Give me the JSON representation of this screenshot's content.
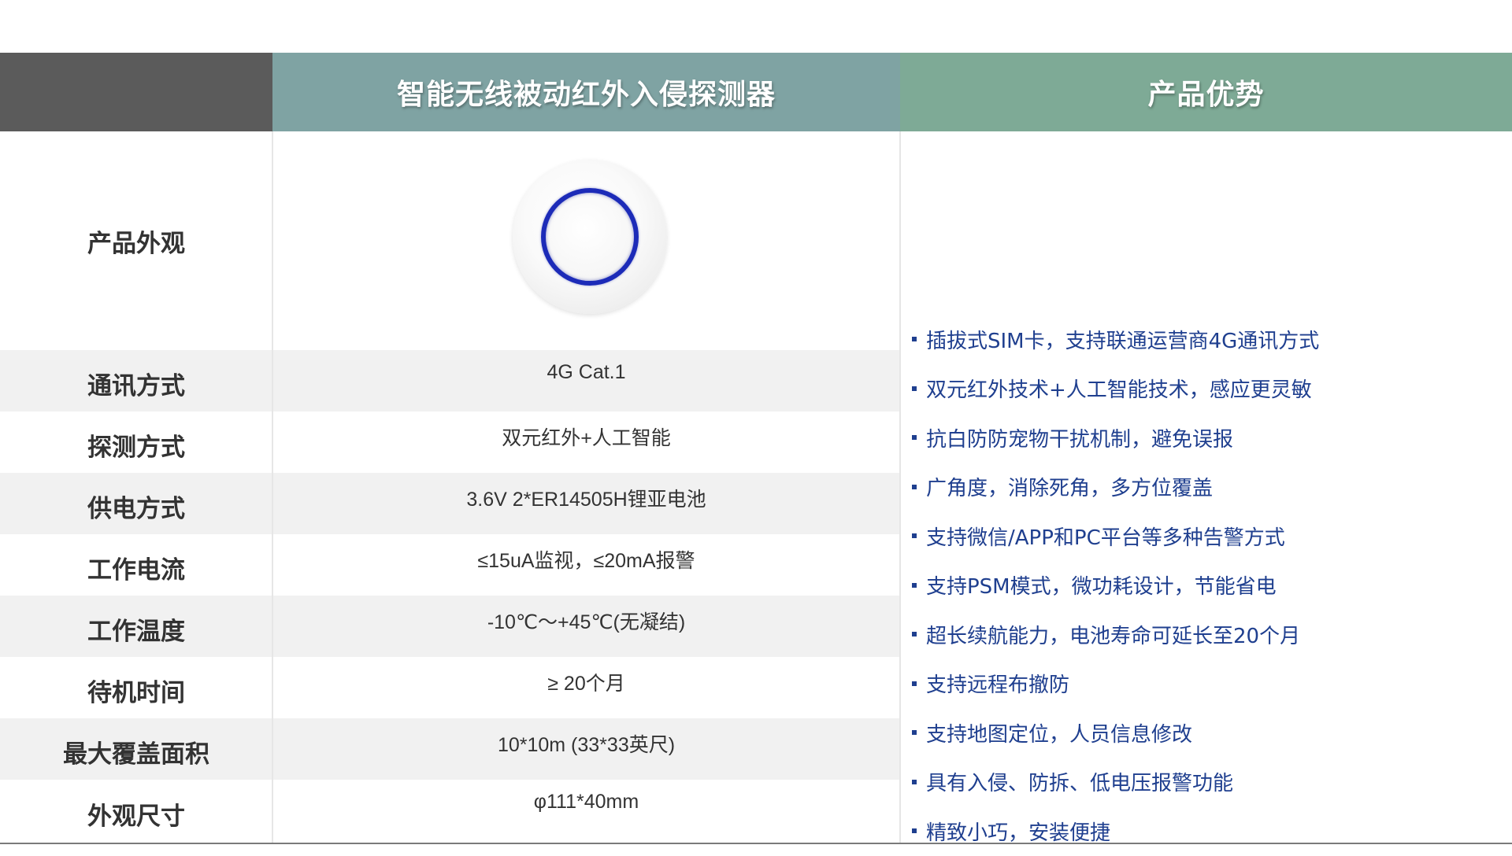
{
  "header": {
    "product_title": "智能无线被动红外入侵探测器",
    "advantages_title": "产品优势"
  },
  "appearance_label": "产品外观",
  "specs": [
    {
      "label": "通讯方式",
      "value": "4G Cat.1"
    },
    {
      "label": "探测方式",
      "value": "双元红外+人工智能"
    },
    {
      "label": "供电方式",
      "value": "3.6V  2*ER14505H锂亚电池"
    },
    {
      "label": "工作电流",
      "value": "≤15uA监视，≤20mA报警"
    },
    {
      "label": "工作温度",
      "value": "-10℃～+45℃(无凝结)"
    },
    {
      "label": "待机时间",
      "value": "≥ 20个月"
    },
    {
      "label": "最大覆盖面积",
      "value": "10*10m (33*33英尺)"
    },
    {
      "label": "外观尺寸",
      "value": "φ111*40mm"
    }
  ],
  "advantages": [
    "插拔式SIM卡，支持联通运营商4G通讯方式",
    "双元红外技术+人工智能技术，感应更灵敏",
    "抗白防防宠物干扰机制，避免误报",
    "广角度，消除死角，多方位覆盖",
    "支持微信/APP和PC平台等多种告警方式",
    "支持PSM模式，微功耗设计，节能省电",
    "超长续航能力，电池寿命可延长至20个月",
    "支持远程布撤防",
    "支持地图定位，人员信息修改",
    "具有入侵、防拆、低电压报警功能",
    "精致小巧，安装便捷"
  ],
  "colors": {
    "header_blank": "#5b5b5b",
    "header_product": "#7fa3a3",
    "header_advantages": "#7eaa96",
    "advantage_text": "#1f3f8f",
    "row_shade": "#f1f1f1",
    "device_ring": "#1c2bb8"
  }
}
